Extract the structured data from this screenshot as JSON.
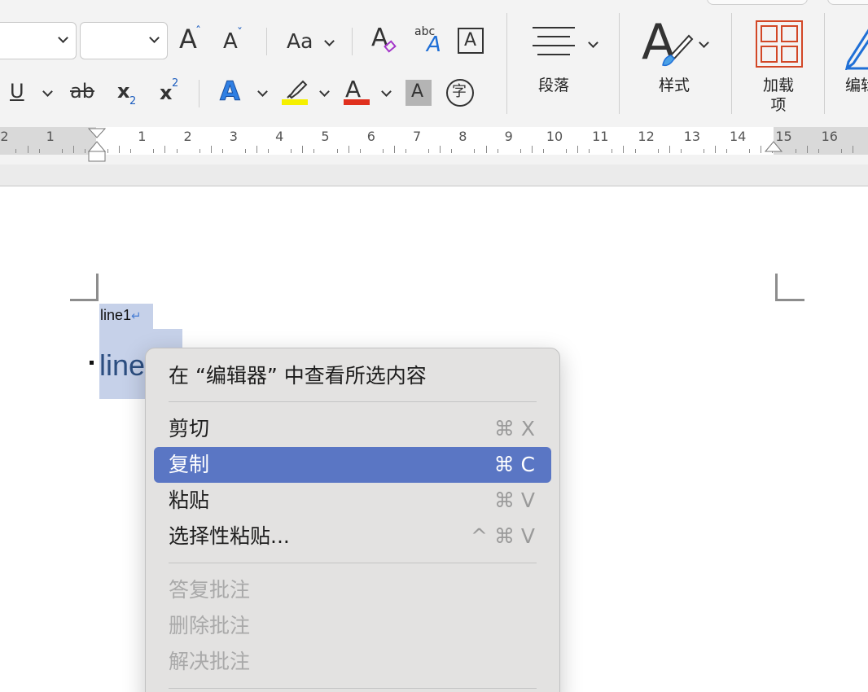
{
  "ribbon": {
    "font_size_up": "A",
    "font_size_down": "A",
    "change_case": "Aa",
    "clear_format": "A",
    "phonetic_small": "abc",
    "phonetic_big": "A",
    "char_border": "A",
    "underline": "U",
    "strikethrough": "ab",
    "subscript": "x",
    "subscript_mark": "2",
    "superscript": "x",
    "superscript_mark": "2",
    "text_effects": "A",
    "font_color": "A",
    "char_shading": "A",
    "enclose_char": "字",
    "paragraph_label": "段落",
    "styles_label": "样式",
    "addins_label": "加载\n项",
    "addins_label_line1": "加载",
    "addins_label_line2": "项",
    "editor_label": "编辑",
    "highlight_color": "#f5f000",
    "font_color_bar": "#e0301e",
    "addins_color": "#d24726"
  },
  "ruler": {
    "numbers": [
      "2",
      "1",
      "1",
      "2",
      "3",
      "4",
      "5",
      "6",
      "7",
      "8",
      "9",
      "10",
      "11",
      "12",
      "13",
      "14",
      "15",
      "16"
    ]
  },
  "document": {
    "line1": "line1",
    "line1_mark": "↵",
    "line2_fragment": "line"
  },
  "context_menu": {
    "header": "在 “编辑器” 中查看所选内容",
    "items": [
      {
        "label": "剪切",
        "shortcut": "⌘ X"
      },
      {
        "label": "复制",
        "shortcut": "⌘ C"
      },
      {
        "label": "粘贴",
        "shortcut": "⌘ V"
      },
      {
        "label": "选择性粘贴...",
        "shortcut": "^ ⌘ V"
      }
    ],
    "comment_items": [
      {
        "label": "答复批注"
      },
      {
        "label": "删除批注"
      },
      {
        "label": "解决批注"
      }
    ],
    "highlight_color": "#5a76c4"
  }
}
